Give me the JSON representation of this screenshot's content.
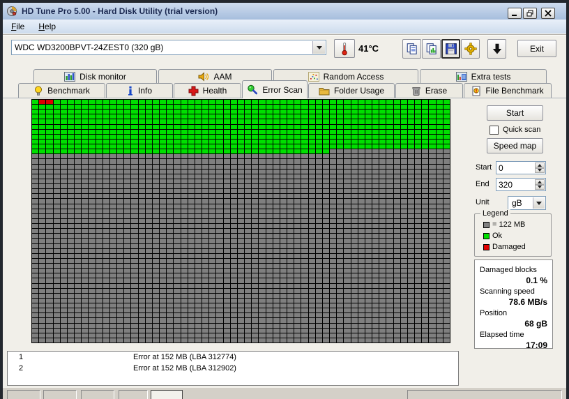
{
  "window": {
    "title": "HD Tune Pro 5.00 - Hard Disk Utility (trial version)"
  },
  "menu": {
    "items": [
      {
        "label": "File"
      },
      {
        "label": "Help"
      }
    ]
  },
  "toolbar": {
    "drive_selected": "WDC WD3200BPVT-24ZEST0 (320 gB)",
    "temperature": "41°C",
    "exit_label": "Exit",
    "buttons": [
      {
        "icon": "copy-icon"
      },
      {
        "icon": "copy-image-icon"
      },
      {
        "icon": "save-icon",
        "pressed": true
      },
      {
        "icon": "tools-icon"
      },
      {
        "icon": "download-arrow-icon"
      }
    ]
  },
  "tabs": {
    "active": "Error Scan",
    "row1": [
      {
        "label": "Disk monitor",
        "icon": "bar-chart-icon"
      },
      {
        "label": "AAM",
        "icon": "speaker-icon"
      },
      {
        "label": "Random Access",
        "icon": "scatter-icon"
      },
      {
        "label": "Extra tests",
        "icon": "chart-grid-icon"
      }
    ],
    "row2": [
      {
        "label": "Benchmark",
        "icon": "bulb-icon"
      },
      {
        "label": "Info",
        "icon": "info-icon"
      },
      {
        "label": "Health",
        "icon": "health-cross-icon"
      },
      {
        "label": "Error Scan",
        "icon": "magnifier-icon"
      },
      {
        "label": "Folder Usage",
        "icon": "folder-icon"
      },
      {
        "label": "Erase",
        "icon": "trash-icon"
      },
      {
        "label": "File Benchmark",
        "icon": "file-benchmark-icon"
      }
    ]
  },
  "scan": {
    "start_button": "Start",
    "quick_scan_label": "Quick scan",
    "quick_scan_checked": false,
    "speed_map_button": "Speed map",
    "start_label": "Start",
    "start_value": "0",
    "end_label": "End",
    "end_value": "320",
    "unit_label": "Unit",
    "unit_value": "gB",
    "legend": {
      "title": "Legend",
      "unscanned_label": "= 122 MB",
      "ok_label": "Ok",
      "damaged_label": "Damaged"
    },
    "status": {
      "damaged_blocks_label": "Damaged blocks",
      "damaged_blocks_value": "0.1 %",
      "scanning_speed_label": "Scanning speed",
      "scanning_speed_value": "78.6 MB/s",
      "position_label": "Position",
      "position_value": "68 gB",
      "elapsed_label": "Elapsed time",
      "elapsed_value": "17:09"
    },
    "errors": [
      {
        "num": "1",
        "text": "Error at 152 MB (LBA 312774)"
      },
      {
        "num": "2",
        "text": "Error at 152 MB (LBA 312902)"
      }
    ]
  },
  "grid": {
    "cols": 59,
    "rows": 49,
    "scanned_full_rows": 10,
    "partial_row_scanned_cols": 42,
    "damaged_cells": [
      [
        0,
        1
      ],
      [
        0,
        2
      ]
    ],
    "colors": {
      "ok": "#00df00",
      "damaged": "#e00000",
      "unscanned": "#7f7f7f",
      "line": "#000000"
    }
  }
}
